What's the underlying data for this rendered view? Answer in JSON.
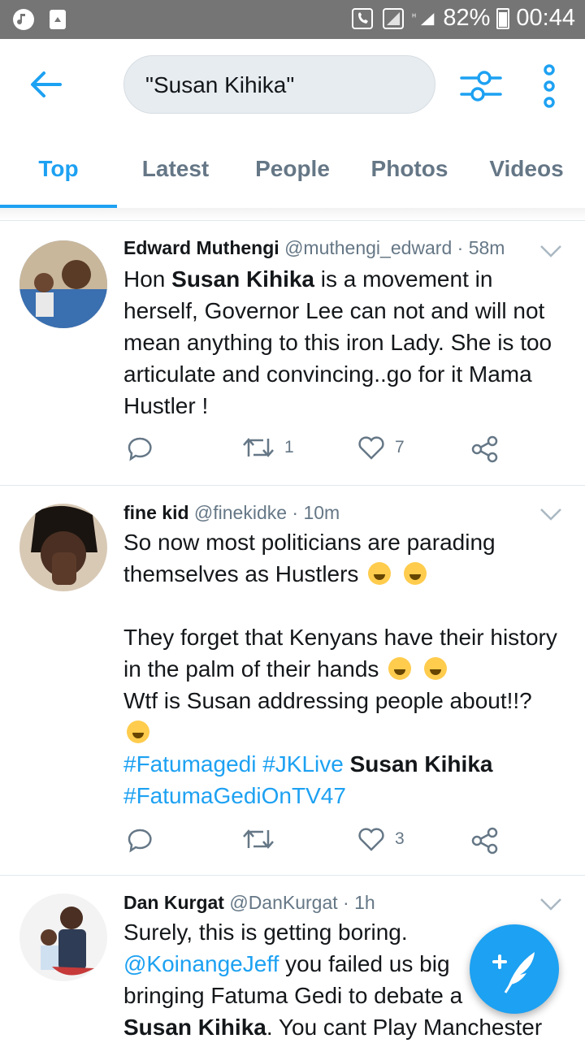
{
  "status": {
    "battery": "82%",
    "time": "00:44"
  },
  "search": {
    "query": "\"Susan Kihika\""
  },
  "tabs": [
    "Top",
    "Latest",
    "People",
    "Photos",
    "Videos"
  ],
  "tweets": [
    {
      "name": "Edward Muthengi",
      "handle": "@muthengi_edward",
      "time": "· 58m",
      "text_pre": "Hon ",
      "text_bold": "Susan Kihika",
      "text_post": " is a movement in herself, Governor Lee can not and will not mean anything to this iron Lady. She is too articulate and convincing..go for it Mama Hustler !",
      "retweets": "1",
      "likes": "7"
    },
    {
      "name": "fine kid",
      "handle": "@finekidke",
      "time": "· 10m",
      "line1": "So now most politicians are parading themselves as Hustlers",
      "line2": "They forget that Kenyans have their history in the palm of their hands",
      "line3": "Wtf is Susan addressing people about!!?",
      "tags": [
        "#Fatumagedi",
        "#JKLive",
        "#FatumaGediOnTV47"
      ],
      "bold": "Susan Kihika",
      "retweets": "",
      "likes": "3"
    },
    {
      "name": "Dan Kurgat",
      "handle": "@DanKurgat",
      "time": "· 1h",
      "line1": "Surely, this is getting boring.",
      "mention": "@KoinangeJeff",
      "line2_rest": " you failed us big",
      "line3": "bringing Fatuma Gedi to debate a",
      "bold": "Susan Kihika",
      "line4_rest": ". You cant Play Manchester"
    }
  ],
  "colors": {
    "accent": "#1da1f2",
    "muted": "#657786",
    "status_bar": "#757575"
  }
}
